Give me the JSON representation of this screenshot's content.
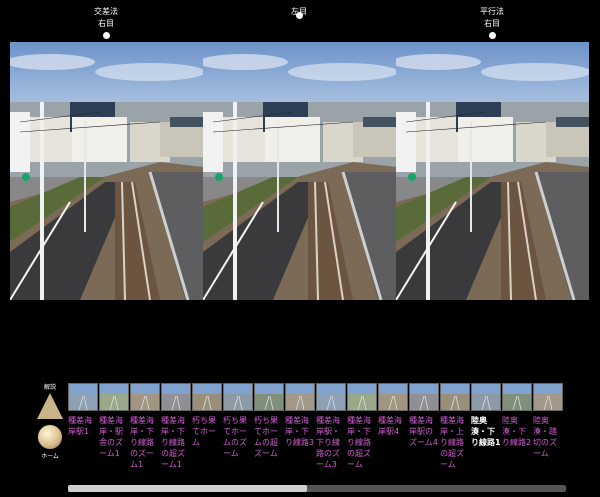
{
  "views": [
    {
      "line1": "交差法",
      "line2": "右目"
    },
    {
      "line1": "左目",
      "line2": ""
    },
    {
      "line1": "平行法",
      "line2": "右目"
    }
  ],
  "controls": {
    "guide_label": "解説",
    "home_label": "ホーム"
  },
  "thumbnails": [
    {
      "caption": "種差海岸駅1"
    },
    {
      "caption": "種差海岸・駅舎のズーム1"
    },
    {
      "caption": "種差海岸・下り線路のズーム1"
    },
    {
      "caption": "種差海岸・下り線路の超ズーム1"
    },
    {
      "caption": "朽ち果てホーム"
    },
    {
      "caption": "朽ち果てホームのズーム"
    },
    {
      "caption": "朽ち果てホームの超ズーム"
    },
    {
      "caption": "種差海岸・下り線路3"
    },
    {
      "caption": "種差海岸駅・下り線路のズーム3"
    },
    {
      "caption": "種差海岸・下り線路の超ズーム"
    },
    {
      "caption": "種差海岸駅4"
    },
    {
      "caption": "種差海岸駅のズーム4"
    },
    {
      "caption": "種差海岸・上り線路の超ズーム"
    },
    {
      "caption": "陸奥湊・下り線路1"
    },
    {
      "caption": "陸奥湊・下り線路2"
    },
    {
      "caption": "陸奥湊・踏切のズーム"
    }
  ],
  "active_thumbnail": 13,
  "scroll_fraction": 0.48,
  "colors": {
    "caption": "#cf5fd0",
    "active_caption": "#ffffff",
    "background": "#000000"
  }
}
